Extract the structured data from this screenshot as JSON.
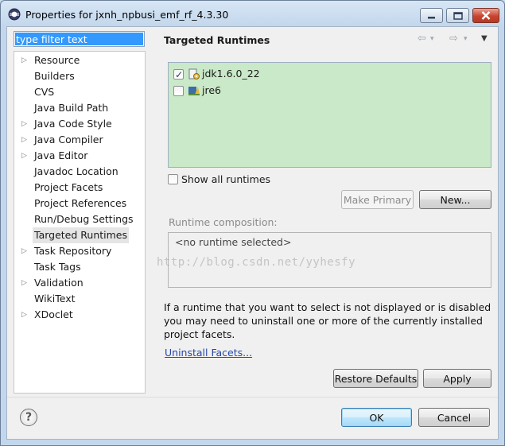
{
  "window": {
    "title": "Properties for jxnh_npbusi_emf_rf_4.3.30",
    "controls": [
      "minimize-icon",
      "maximize-icon",
      "close-icon"
    ]
  },
  "filter": {
    "value": "type filter text"
  },
  "tree": {
    "items": [
      {
        "label": "Resource",
        "expandable": true
      },
      {
        "label": "Builders",
        "expandable": false
      },
      {
        "label": "CVS",
        "expandable": false
      },
      {
        "label": "Java Build Path",
        "expandable": false
      },
      {
        "label": "Java Code Style",
        "expandable": true
      },
      {
        "label": "Java Compiler",
        "expandable": true
      },
      {
        "label": "Java Editor",
        "expandable": true
      },
      {
        "label": "Javadoc Location",
        "expandable": false
      },
      {
        "label": "Project Facets",
        "expandable": false
      },
      {
        "label": "Project References",
        "expandable": false
      },
      {
        "label": "Run/Debug Settings",
        "expandable": false
      },
      {
        "label": "Targeted Runtimes",
        "expandable": false,
        "selected": true
      },
      {
        "label": "Task Repository",
        "expandable": true
      },
      {
        "label": "Task Tags",
        "expandable": false
      },
      {
        "label": "Validation",
        "expandable": true
      },
      {
        "label": "WikiText",
        "expandable": false
      },
      {
        "label": "XDoclet",
        "expandable": true
      }
    ]
  },
  "watermark": "http://blog.csdn.net/yyhesfy",
  "page": {
    "title": "Targeted Runtimes",
    "runtimes": [
      {
        "label": "jdk1.6.0_22",
        "checked": true
      },
      {
        "label": "jre6",
        "checked": false
      }
    ],
    "show_all_label": "Show all runtimes",
    "make_primary_label": "Make Primary",
    "new_label": "New...",
    "composition_label": "Runtime composition:",
    "composition_text": "<no runtime selected>",
    "info_text": "If a runtime that you want to select is not displayed or is disabled you may need to uninstall one or more of the currently installed project facets.",
    "uninstall_link": "Uninstall Facets...",
    "restore_label": "Restore Defaults",
    "apply_label": "Apply"
  },
  "footer": {
    "ok_label": "OK",
    "cancel_label": "Cancel",
    "help_glyph": "?"
  },
  "colors": {
    "runtime_list_bg": "#cae9c8",
    "selection": "#3399ff",
    "link": "#2547a8"
  }
}
